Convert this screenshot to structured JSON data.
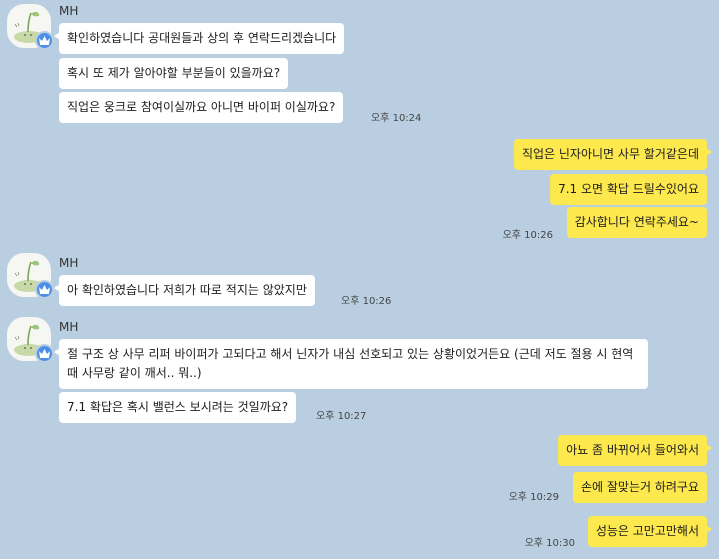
{
  "contact": {
    "name": "MH"
  },
  "colors": {
    "background": "#b9cfe1",
    "incoming": "#ffffff",
    "outgoing": "#fde84e",
    "badge": "#4d8ee6"
  },
  "groups": [
    {
      "sender": "MH",
      "messages": [
        "확인하였습니다 공대원들과 상의 후 연락드리겠습니다",
        "혹시 또 제가 알아야할 부분들이 있을까요?",
        "직업은 웅크로 참여이실까요 아니면 바이퍼 이실까요?"
      ],
      "time": "오후 10:24"
    },
    {
      "sender": "me",
      "messages": [
        "직업은 닌자아니면 사무 할거같은데",
        "7.1 오면 확답 드릴수있어요",
        "감사합니다 연락주세요~"
      ],
      "time": "오후 10:26"
    },
    {
      "sender": "MH",
      "messages": [
        "아 확인하였습니다 저희가 따로 적지는 않았지만"
      ],
      "time": "오후 10:26"
    },
    {
      "sender": "MH",
      "messages": [
        "절 구조 상 사무 리퍼 바이퍼가 고되다고 해서 닌자가 내심 선호되고 있는 상황이었거든요 (근데 저도 절용 시 현역 때 사무랑 같이 깨서.. 뭐..)",
        "7.1 확답은 혹시 밸런스 보시려는 것일까요?"
      ],
      "time": "오후 10:27"
    },
    {
      "sender": "me",
      "messages": [
        "아뇨 좀 바뀌어서 들어와서",
        "손에 잘맞는거 하려구요"
      ],
      "time": "오후 10:29"
    },
    {
      "sender": "me",
      "messages": [
        "성능은 고만고만해서"
      ],
      "time": "오후 10:30"
    }
  ]
}
